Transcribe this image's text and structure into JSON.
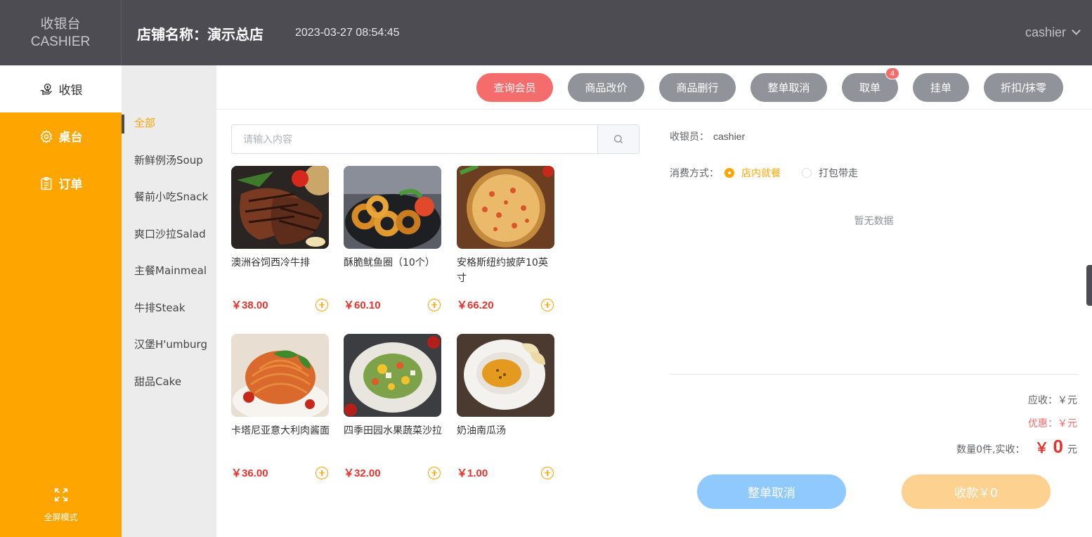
{
  "brand": {
    "cn": "收银台",
    "en": "CASHIER"
  },
  "header": {
    "store": "店铺名称：演示总店",
    "datetime": "2023-03-27 08:54:45",
    "user": "cashier"
  },
  "nav": {
    "items": [
      {
        "label": "收银",
        "icon": "cashier-hand-icon",
        "active": true
      },
      {
        "label": "桌台",
        "icon": "table-gear-icon",
        "active": false
      },
      {
        "label": "订单",
        "icon": "order-clipboard-icon",
        "active": false
      }
    ],
    "fullscreen": "全屏模式"
  },
  "categories": [
    "全部",
    "新鲜例汤Soup",
    "餐前小吃Snack",
    "爽口沙拉Salad",
    "主餐Mainmeal",
    "牛排Steak",
    "汉堡H'umburg",
    "甜品Cake"
  ],
  "toolbar": {
    "buttons": [
      "查询会员",
      "商品改价",
      "商品删行",
      "整单取消",
      "取单",
      "挂单",
      "折扣/抹零"
    ],
    "badge": "4"
  },
  "search": {
    "placeholder": "请输入内容"
  },
  "products": [
    {
      "name": "澳洲谷饲西冷牛排",
      "price": "￥38.00"
    },
    {
      "name": "酥脆鱿鱼圈（10个）",
      "price": "￥60.10"
    },
    {
      "name": "安格斯纽约披萨10英寸",
      "price": "￥66.20"
    },
    {
      "name": "卡塔尼亚意大利肉酱面",
      "price": "￥36.00"
    },
    {
      "name": "四季田园水果蔬菜沙拉",
      "price": "￥32.00"
    },
    {
      "name": "奶油南瓜汤",
      "price": "￥1.00"
    }
  ],
  "order": {
    "cashier_label": "收银员：",
    "cashier_name": "cashier",
    "mode_label": "消费方式：",
    "mode_dine_in": "店内就餐",
    "mode_takeaway": "打包带走",
    "empty": "暂无数据",
    "receivable": "应收：￥元",
    "discount": "优惠：￥元",
    "qty_label": "数量0件,实收：",
    "currency": "￥",
    "amount": "0",
    "unit": "元",
    "cancel_btn": "整单取消",
    "pay_btn": "收款￥0"
  },
  "colors": {
    "accent": "#ffa500",
    "header": "#4d4c52",
    "danger": "#f56c6c",
    "price": "#e5322d"
  }
}
